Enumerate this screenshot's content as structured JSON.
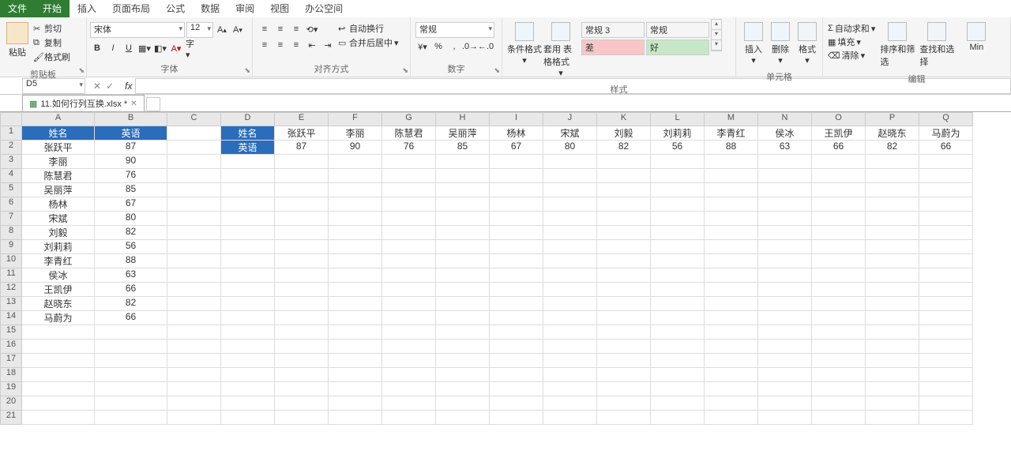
{
  "menu": {
    "file": "文件",
    "tabs": [
      "开始",
      "插入",
      "页面布局",
      "公式",
      "数据",
      "审阅",
      "视图",
      "办公空间"
    ],
    "active": 0
  },
  "ribbon": {
    "clipboard": {
      "label": "剪贴板",
      "paste": "粘贴",
      "cut": "剪切",
      "copy": "复制",
      "painter": "格式刷"
    },
    "font": {
      "label": "字体",
      "name": "宋体",
      "size": "12",
      "bold": "B",
      "italic": "I",
      "underline": "U",
      "grow": "A",
      "shrink": "A"
    },
    "align": {
      "label": "对齐方式",
      "wrap": "自动换行",
      "merge": "合并后居中"
    },
    "number": {
      "label": "数字",
      "format": "常规"
    },
    "styles": {
      "label": "样式",
      "cond": "条件格式",
      "table": "套用\n表格格式",
      "normal3": "常规 3",
      "normal": "常规",
      "bad": "差",
      "good": "好"
    },
    "cells": {
      "label": "单元格",
      "insert": "插入",
      "delete": "删除",
      "format": "格式"
    },
    "editing": {
      "label": "编辑",
      "sum": "自动求和",
      "fill": "填充",
      "clear": "清除",
      "sort": "排序和筛选",
      "find": "查找和选择",
      "min": "Min"
    }
  },
  "nameBox": "D5",
  "sheetTab": "11.如何行列互换.xlsx *",
  "columns": [
    "A",
    "B",
    "C",
    "D",
    "E",
    "F",
    "G",
    "H",
    "I",
    "J",
    "K",
    "L",
    "M",
    "N",
    "O",
    "P",
    "Q"
  ],
  "colWidths": {
    "A": 92,
    "B": 92,
    "C": 68,
    "D": 68,
    "E": 68,
    "F": 68,
    "G": 68,
    "H": 68,
    "I": 68,
    "J": 68,
    "K": 68,
    "L": 68,
    "M": 68,
    "N": 68,
    "O": 68,
    "P": 68,
    "Q": 68
  },
  "rows": [
    1,
    2,
    3,
    4,
    5,
    6,
    7,
    8,
    9,
    10,
    11,
    12,
    13,
    14,
    15,
    16,
    17,
    18,
    19,
    20,
    21
  ],
  "headersAB": {
    "A": "姓名",
    "B": "英语"
  },
  "dataAB": [
    {
      "name": "张跃平",
      "score": 87
    },
    {
      "name": "李丽",
      "score": 90
    },
    {
      "name": "陈慧君",
      "score": 76
    },
    {
      "name": "吴丽萍",
      "score": 85
    },
    {
      "name": "杨林",
      "score": 67
    },
    {
      "name": "宋斌",
      "score": 80
    },
    {
      "name": "刘毅",
      "score": 82
    },
    {
      "name": "刘莉莉",
      "score": 56
    },
    {
      "name": "李青红",
      "score": 88
    },
    {
      "name": "侯冰",
      "score": 63
    },
    {
      "name": "王凯伊",
      "score": 66
    },
    {
      "name": "赵晓东",
      "score": 82
    },
    {
      "name": "马蔚为",
      "score": 66
    }
  ],
  "transposed": {
    "D1": "姓名",
    "D2": "英语",
    "row1": [
      "张跃平",
      "李丽",
      "陈慧君",
      "吴丽萍",
      "杨林",
      "宋斌",
      "刘毅",
      "刘莉莉",
      "李青红",
      "侯冰",
      "王凯伊",
      "赵晓东",
      "马蔚为"
    ],
    "row2": [
      87,
      90,
      76,
      85,
      67,
      80,
      82,
      56,
      88,
      63,
      66,
      82,
      66
    ]
  }
}
